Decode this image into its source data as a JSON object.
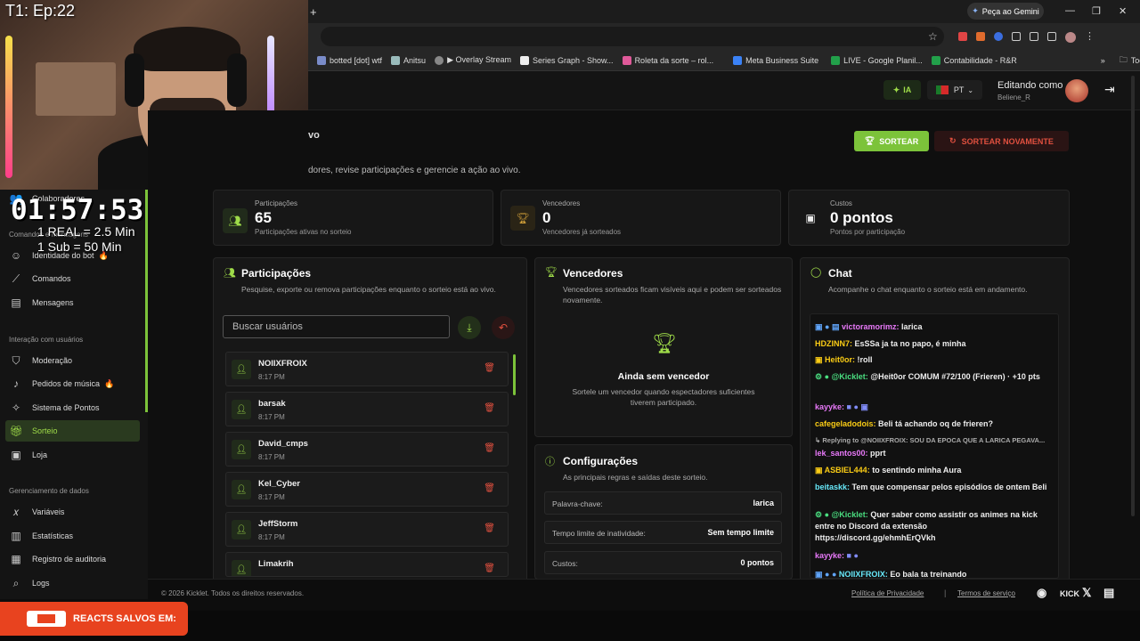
{
  "browser": {
    "gemini_label": "Peça ao Gemini",
    "bookmarks": [
      "botted [dot] wtf",
      "Anitsu",
      "▶ Overlay Stream",
      "Series Graph - Show...",
      "Roleta da sorte – rol...",
      "Meta Business Suite",
      "LIVE - Google Planil...",
      "Contabilidade - R&R"
    ],
    "bookmarks_more": "»",
    "bookmarks_folder": "Todos os favoritos"
  },
  "overlay": {
    "episode": "T1: Ep:22",
    "timer": "01:57:53",
    "rate1": "1 REAL = 2.5 Min",
    "rate2": "1 Sub = 50 Min",
    "reacts": "REACTS SALVOS EM:"
  },
  "sidebar": {
    "top_item": "Colaboradores",
    "section1": "Comandos e mensagens",
    "items1": [
      "Identidade do bot",
      "Comandos",
      "Mensagens"
    ],
    "section2": "Interação com usuários",
    "items2": [
      "Moderação",
      "Pedidos de música",
      "Sistema de Pontos",
      "Sorteio",
      "Loja"
    ],
    "section3": "Gerenciamento de dados",
    "items3": [
      "Variáveis",
      "Estatísticas",
      "Registro de auditoria",
      "Logs"
    ]
  },
  "topbar": {
    "ia": "IA",
    "lang": "PT",
    "editing": "Editando como",
    "user": "Beliene_R"
  },
  "page": {
    "title": "vo",
    "subtitle": "dores, revise participações e gerencie a ação ao vivo.",
    "btn_draw": "SORTEAR",
    "btn_redraw": "SORTEAR NOVAMENTE"
  },
  "stats": [
    {
      "label": "Participações",
      "value": "65",
      "sub": "Participações ativas no sorteio"
    },
    {
      "label": "Vencedores",
      "value": "0",
      "sub": "Vencedores já sorteados"
    },
    {
      "label": "Custos",
      "value": "0 pontos",
      "sub": "Pontos por participação"
    }
  ],
  "participants": {
    "title": "Participações",
    "subtitle": "Pesquise, exporte ou remova participações enquanto o sorteio está ao vivo.",
    "search_placeholder": "Buscar usuários",
    "rows": [
      {
        "name": "NOIIXFROIX",
        "time": "8:17 PM"
      },
      {
        "name": "barsak",
        "time": "8:17 PM"
      },
      {
        "name": "David_cmps",
        "time": "8:17 PM"
      },
      {
        "name": "Kel_Cyber",
        "time": "8:17 PM"
      },
      {
        "name": "JeffStorm",
        "time": "8:17 PM"
      },
      {
        "name": "Limakrih",
        "time": "8:17 PM"
      }
    ]
  },
  "winners": {
    "title": "Vencedores",
    "subtitle": "Vencedores sorteados ficam visíveis aqui e podem ser sorteados novamente.",
    "empty_title": "Ainda sem vencedor",
    "empty_sub": "Sortele um vencedor quando espectadores suficientes tiverem participado."
  },
  "config": {
    "title": "Configurações",
    "subtitle": "As principais regras e saídas deste sorteio.",
    "rows": [
      {
        "k": "Palavra-chave:",
        "v": "larica"
      },
      {
        "k": "Tempo limite de inatividade:",
        "v": "Sem tempo limite"
      },
      {
        "k": "Custos:",
        "v": "0 pontos"
      }
    ]
  },
  "chat": {
    "title": "Chat",
    "subtitle": "Acompanhe o chat enquanto o sorteio está em andamento.",
    "messages": [
      {
        "user": "victoramorimz:",
        "text": " larica",
        "color": "#e879f9"
      },
      {
        "user": "HDZINN7:",
        "text": " EsSSa ja ta no papo, é minha",
        "color": "#facc15"
      },
      {
        "user": "Heit0or:",
        "text": " !roll",
        "color": "#facc15"
      },
      {
        "user": "@Kicklet:",
        "text": " @Heit0or COMUM #72/100 (Frieren) · +10 pts",
        "color": "#4ade80"
      },
      {
        "user": "kayyke:",
        "text": "",
        "color": "#e879f9"
      },
      {
        "user": "cafegeladodois:",
        "text": " Beli tá achando oq de frieren?",
        "color": "#facc15"
      },
      {
        "user": "",
        "text": "Replying to @NOIIXFROIX: SOU DA EPOCA QUE A LARICA PEGAVA...",
        "color": "#aaa"
      },
      {
        "user": "lek_santos00:",
        "text": " pprt",
        "color": "#e879f9"
      },
      {
        "user": "ASBIEL444:",
        "text": " to sentindo minha Aura",
        "color": "#facc15"
      },
      {
        "user": "beitaskk:",
        "text": " Tem que compensar pelos episódios de ontem Beli",
        "color": "#67e8f9"
      },
      {
        "user": "@Kicklet:",
        "text": " Quer saber como assistir os animes na kick entre no Discord da extensão https://discord.gg/ehmhErQVkh",
        "color": "#4ade80"
      },
      {
        "user": "kayyke:",
        "text": "",
        "color": "#e879f9"
      },
      {
        "user": "NOIIXFROIX:",
        "text": " Eo bala ta treinando",
        "color": "#67e8f9"
      }
    ]
  },
  "footer": {
    "copyright": "© 2026 Kicklet. Todos os direitos reservados.",
    "privacy": "Política de Privacidade",
    "sep": "|",
    "terms": "Termos de serviço",
    "kick": "KICK"
  }
}
